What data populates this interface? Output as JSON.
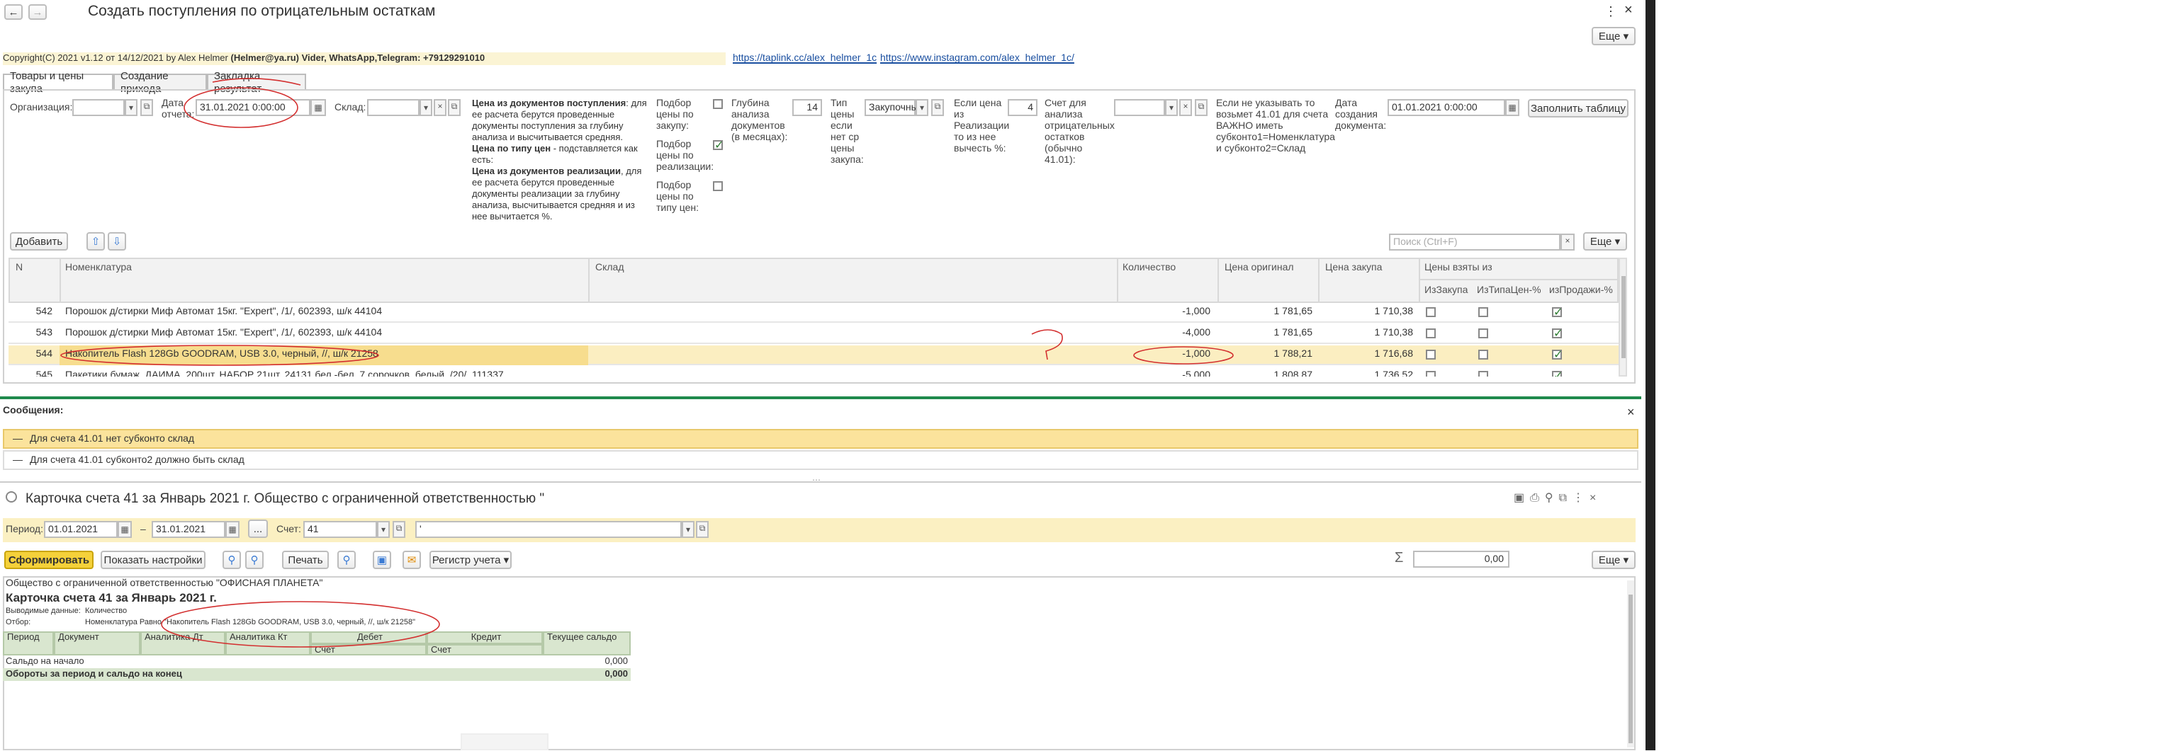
{
  "window": {
    "title": "Создать поступления по отрицательным остаткам",
    "more_label": "Еще",
    "copyright": "Copyright(C)  2021 v1.12 от 14/12/2021  by Alex Helmer",
    "copyright_bold": "(Helmer@ya.ru) Vider, WhatsApp,Telegram: +79129291010",
    "link1": "https://taplink.cc/alex_helmer_1c",
    "link2": "https://www.instagram.com/alex_helmer_1c/"
  },
  "tabs": [
    "Товары и цены закупа",
    "Создание прихода",
    "Закладка результат"
  ],
  "filters": {
    "org_label": "Организация:",
    "date_label": "Дата отчета:",
    "date_value": "31.01.2021  0:00:00",
    "warehouse_label": "Склад:",
    "help_title1": "Цена из документов поступления",
    "help_text1": ": для ее расчета берутся проведенные документы поступления за глубину анализа и высчитывается средняя.",
    "help_title2": "Цена по типу цен",
    "help_text2": " - подставляется как есть:",
    "help_title3": "Цена из документов реализации",
    "help_text3": ", для ее расчета берутся проведенные документы реализации за глубину анализа, высчитывается средняя и из нее вычитается %.",
    "pick_purchase": "Подбор цены по закупу:",
    "pick_sales": "Подбор цены по реализации:",
    "pick_type": "Подбор цены по типу цен:",
    "depth_label": "Глубина анализа документов (в месяцах):",
    "depth_value": "14",
    "price_type_label": "Тип цены если нет ср цены закупа:",
    "price_type_value": "Закупочнь",
    "percent_label": "Если цена из Реализации то из нее вычесть %:",
    "percent_value": "4",
    "account_label": "Счет для анализа отрицательных остатков (обычно 41.01):",
    "note": "Если не указывать то возьмет 41.01 для счета ВАЖНО иметь субконто1=Номенклатура и субконто2=Склад",
    "created_label": "Дата создания документа:",
    "created_value": "01.01.2021  0:00:00",
    "fill_button": "Заполнить таблицу"
  },
  "toolbar": {
    "add_label": "Добавить",
    "search_placeholder": "Поиск (Ctrl+F)",
    "more_label": "Еще"
  },
  "table": {
    "headers": {
      "n": "N",
      "item": "Номенклатура",
      "warehouse": "Склад",
      "qty": "Количество",
      "price_orig": "Цена оригинал",
      "price_buy": "Цена закупа",
      "group": "Цены взяты из",
      "c1": "ИзЗакупа",
      "c2": "ИзТипаЦен-%",
      "c3": "изПродажи-%"
    },
    "rows": [
      {
        "n": "542",
        "item": "Порошок д/стирки Миф Автомат 15кг. \"Expert\", /1/, 602393, ш/к 44104",
        "qty": "-1,000",
        "price_orig": "1 781,65",
        "price_buy": "1 710,38"
      },
      {
        "n": "543",
        "item": "Порошок д/стирки Миф Автомат 15кг. \"Expert\", /1/, 602393, ш/к 44104",
        "qty": "-4,000",
        "price_orig": "1 781,65",
        "price_buy": "1 710,38"
      },
      {
        "n": "544",
        "item": "Накопитель Flash 128Gb GOODRAM, USB 3.0, черный, //, ш/к 21258",
        "qty": "-1,000",
        "price_orig": "1 788,21",
        "price_buy": "1 716,68"
      },
      {
        "n": "545",
        "item": "Пакетики бумаж. ДАЙМА, 200шт, НАБОР 21шт, 24131 бел.-бел. 7 сорочков, белый, /20/, 111337",
        "qty": "-5,000",
        "price_orig": "1 808,87",
        "price_buy": "1 736,52"
      }
    ]
  },
  "messages": {
    "title": "Сообщения:",
    "items": [
      "Для счета 41.01 нет субконто склад",
      "Для счета 41.01 субконто2 должно быть склад"
    ]
  },
  "report": {
    "title": "Карточка счета 41 за Январь 2021 г. Общество с ограниченной ответственностью \"",
    "period_label": "Период:",
    "from": "01.01.2021",
    "dash": "–",
    "to": "31.01.2021",
    "dots": "...",
    "account_label": "Счет:",
    "account_value": "41",
    "subconto_value": "'",
    "generate": "Сформировать",
    "settings": "Показать настройки",
    "print": "Печать",
    "register": "Регистр учета",
    "sum_value": "0,00",
    "more_label": "Еще",
    "org": "Общество с ограниченной ответственностью \"ОФИСНАЯ ПЛАНЕТА\"",
    "card_title": "Карточка счета 41 за Январь 2021 г.",
    "output_label": "Выводимые данные:",
    "output_value": "Количество",
    "filter_label": "Отбор:",
    "filter_value": "Номенклатура Равно \"Накопитель Flash 128Gb GOODRAM, USB 3.0, черный, //, ш/к 21258\"",
    "cols": [
      "Период",
      "Документ",
      "Аналитика Дт",
      "Аналитика Кт",
      "Дебет",
      "Кредит",
      "Текущее сальдо"
    ],
    "subcols": [
      "Счет",
      "Счет"
    ],
    "start_label": "Сальдо на начало",
    "start_value": "0,000",
    "end_label": "Обороты за период и сальдо на конец",
    "end_value": "0,000"
  }
}
